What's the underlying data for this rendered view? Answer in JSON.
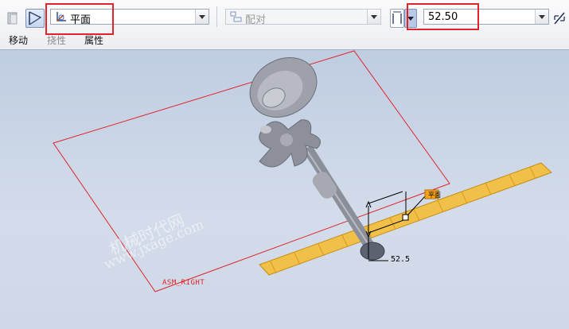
{
  "dashboard": {
    "reference_type": {
      "value": "平面"
    },
    "constraint_type": {
      "value": "配对"
    },
    "offset_value": "52.50",
    "tabs": [
      {
        "label": "移动",
        "enabled": true
      },
      {
        "label": "挠性",
        "enabled": false
      },
      {
        "label": "属性",
        "enabled": true
      }
    ]
  },
  "model": {
    "datum_plane_label": "ASM_RIGHT",
    "offset_dimension": "52.5",
    "handle_tag": "平面"
  },
  "watermark": {
    "line1": "机械时代网",
    "line2": "www.jxage.com"
  },
  "colors": {
    "highlight_box": "#e0242a",
    "datum_plane": "#e0242a",
    "placement_plane": "#f1c048",
    "part_gray": "#8c8f98"
  }
}
